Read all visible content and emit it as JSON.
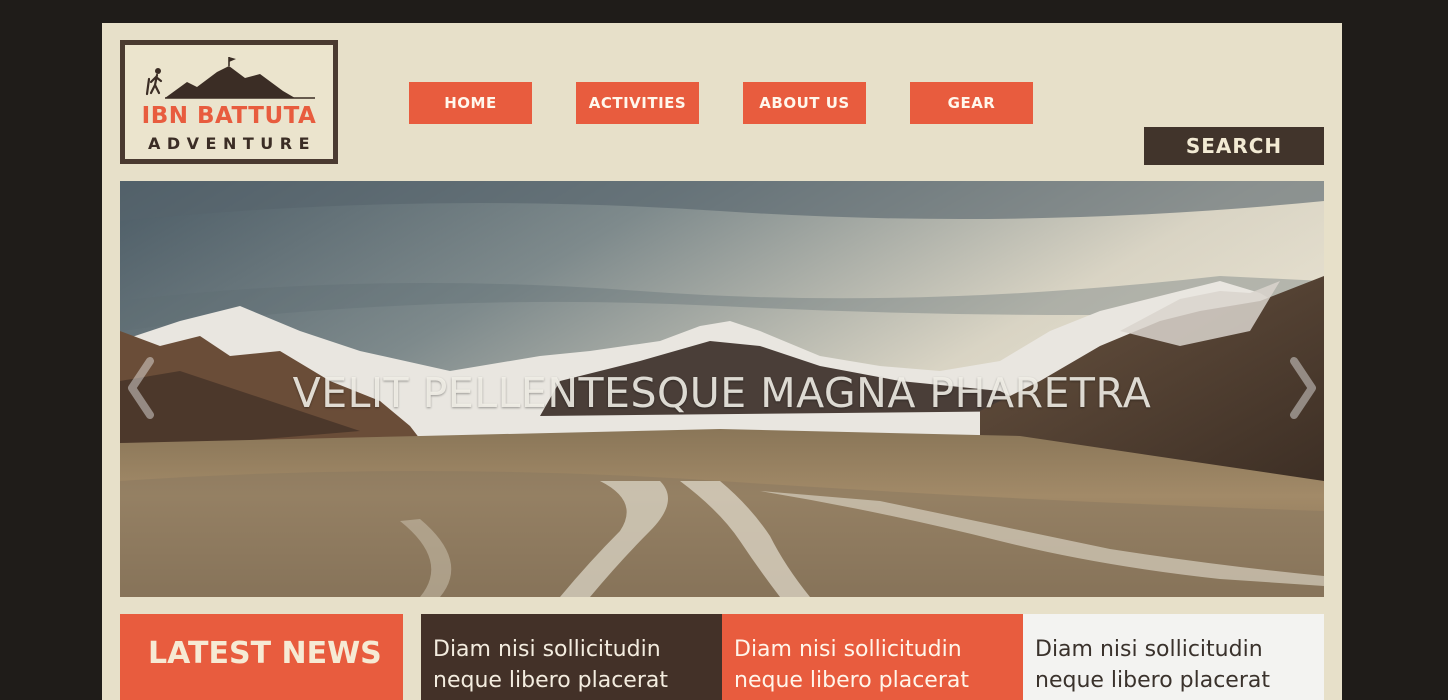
{
  "logo": {
    "title": "IBN BATTUTA",
    "subtitle": "ADVENTURE"
  },
  "nav": {
    "items": [
      {
        "label": "HOME"
      },
      {
        "label": "ACTIVITIES"
      },
      {
        "label": "ABOUT US"
      },
      {
        "label": "GEAR"
      }
    ],
    "search_label": "SEARCH"
  },
  "hero": {
    "caption": "VELIT PELLENTESQUE MAGNA PHARETRA"
  },
  "news": {
    "heading": "LATEST NEWS",
    "cards": [
      {
        "line1": "Diam nisi sollicitudin",
        "line2": "neque libero placerat"
      },
      {
        "line1": "Diam nisi sollicitudin",
        "line2": "neque libero placerat"
      },
      {
        "line1": "Diam nisi sollicitudin",
        "line2": "neque libero placerat"
      }
    ]
  },
  "colors": {
    "accent": "#e85c3e",
    "dark_brown": "#41342b",
    "background": "#e7e0c9",
    "frame": "#1f1c19"
  }
}
